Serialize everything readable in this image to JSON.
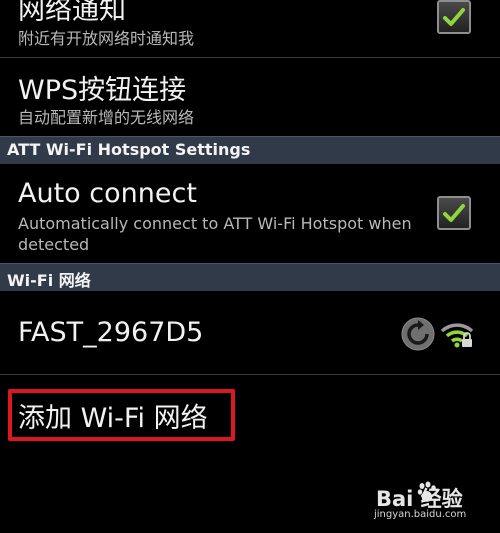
{
  "settings": {
    "network_notify": {
      "title": "网络通知",
      "subtitle": "附近有开放网络时通知我",
      "checked": true
    },
    "wps": {
      "title": "WPS按钮连接",
      "subtitle": "自动配置新增的无线网络"
    },
    "att_header": "ATT Wi-Fi Hotspot Settings",
    "auto_connect": {
      "title": "Auto connect",
      "subtitle": "Automatically connect to ATT Wi-Fi Hotspot when detected",
      "checked": true
    },
    "wifi_header": "Wi-Fi 网络",
    "network": {
      "ssid": "FAST_2967D5",
      "wps_icon": "wps-refresh-icon",
      "signal_icon": "wifi-signal-locked-icon"
    },
    "add_network": "添加 Wi-Fi 网络"
  },
  "watermark": {
    "brand": "Bai 经验",
    "url": "jingyan.baidu.com",
    "icon": "baidu-paw-icon"
  },
  "colors": {
    "background": "#000000",
    "section_header": "#303a48",
    "check_green": "#8fd63c",
    "highlight_red": "#d9191e"
  }
}
